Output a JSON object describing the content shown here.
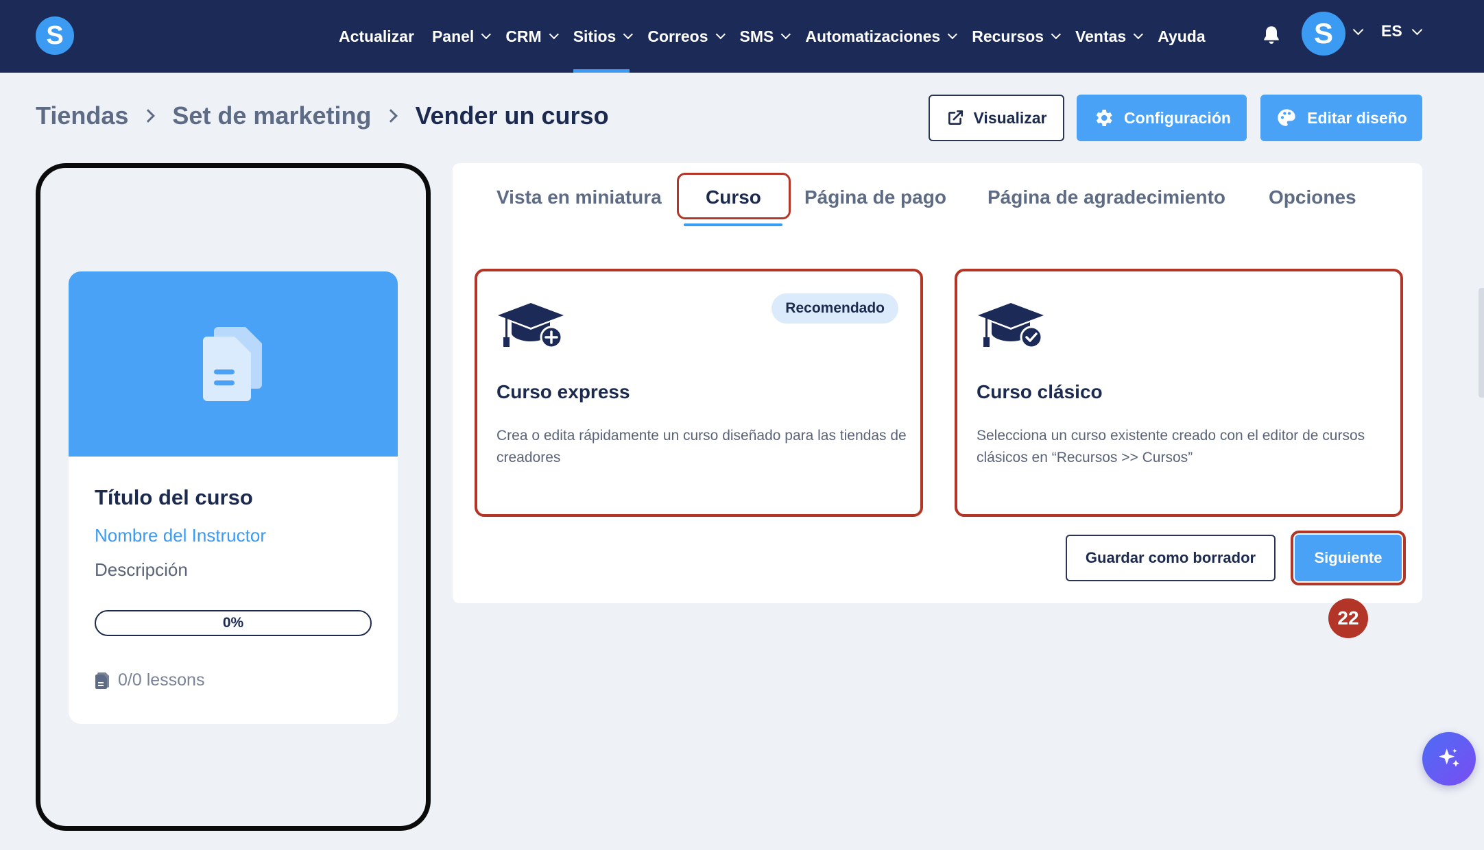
{
  "nav": {
    "logo_letter": "S",
    "items": [
      {
        "label": "Actualizar",
        "dropdown": false
      },
      {
        "label": "Panel",
        "dropdown": true
      },
      {
        "label": "CRM",
        "dropdown": true
      },
      {
        "label": "Sitios",
        "dropdown": true,
        "active": true
      },
      {
        "label": "Correos",
        "dropdown": true
      },
      {
        "label": "SMS",
        "dropdown": true
      },
      {
        "label": "Automatizaciones",
        "dropdown": true
      },
      {
        "label": "Recursos",
        "dropdown": true
      },
      {
        "label": "Ventas",
        "dropdown": true
      },
      {
        "label": "Ayuda",
        "dropdown": false
      }
    ],
    "avatar_letter": "S",
    "language": "ES"
  },
  "breadcrumb": {
    "items": [
      "Tiendas",
      "Set de marketing",
      "Vender un curso"
    ]
  },
  "actions": {
    "preview_label": "Visualizar",
    "settings_label": "Configuración",
    "edit_design_label": "Editar diseño"
  },
  "preview": {
    "title": "Título del curso",
    "instructor": "Nombre del Instructor",
    "description": "Descripción",
    "progress_text": "0%",
    "progress_value": 0,
    "lessons": "0/0 lessons"
  },
  "tabs": [
    {
      "label": "Vista en miniatura",
      "active": false
    },
    {
      "label": "Curso",
      "active": true
    },
    {
      "label": "Página de pago",
      "active": false
    },
    {
      "label": "Página de agradecimiento",
      "active": false
    },
    {
      "label": "Opciones",
      "active": false
    }
  ],
  "options": {
    "express": {
      "badge": "Recomendado",
      "title": "Curso express",
      "description": "Crea o edita rápidamente un curso diseñado para las tiendas de creadores"
    },
    "classic": {
      "title": "Curso clásico",
      "description": "Selecciona un curso existente creado con el editor de cursos clásicos en “Recursos >> Cursos”"
    }
  },
  "footer": {
    "draft_label": "Guardar como borrador",
    "next_label": "Siguiente",
    "step_number": "22"
  },
  "colors": {
    "nav_bg": "#1b2a56",
    "accent": "#4aa2f7",
    "highlight": "#b23528",
    "text_dark": "#1b2a4e"
  }
}
